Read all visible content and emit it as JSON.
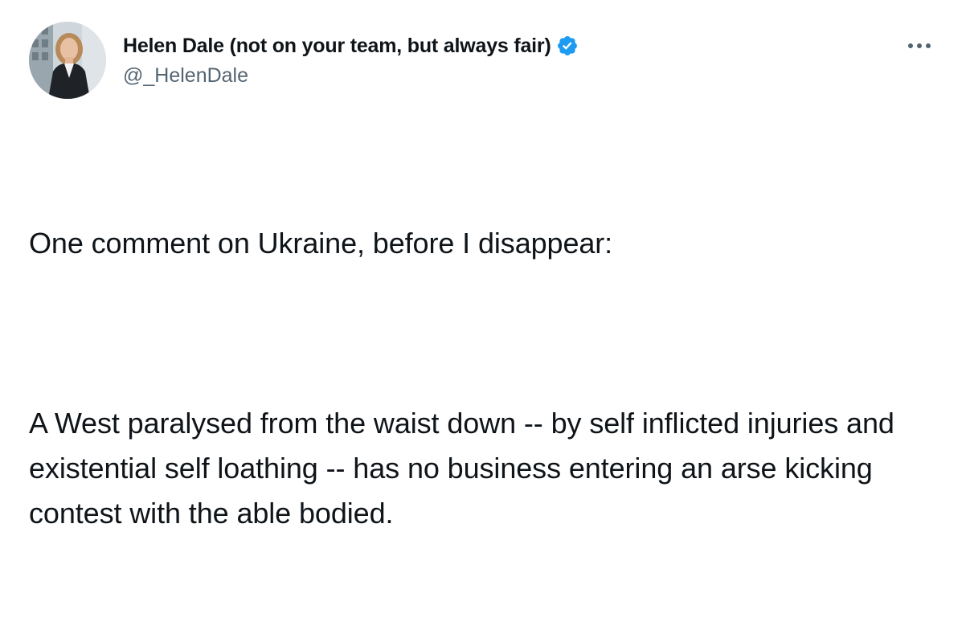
{
  "tweet": {
    "author": {
      "display_name": "Helen Dale (not on your team, but always fair)",
      "handle": "@_HelenDale",
      "verified": true,
      "avatar_icon": "profile-photo"
    },
    "more_icon": "ellipsis-icon",
    "text_paragraphs": [
      "One comment on Ukraine, before I disappear:",
      "A West paralysed from the waist down -- by self inflicted injuries and existential self loathing -- has no business entering an arse kicking contest with the able bodied."
    ]
  },
  "colors": {
    "text_primary": "#0f1419",
    "text_secondary": "#536471",
    "verified_blue": "#1d9bf0",
    "background": "#ffffff"
  }
}
